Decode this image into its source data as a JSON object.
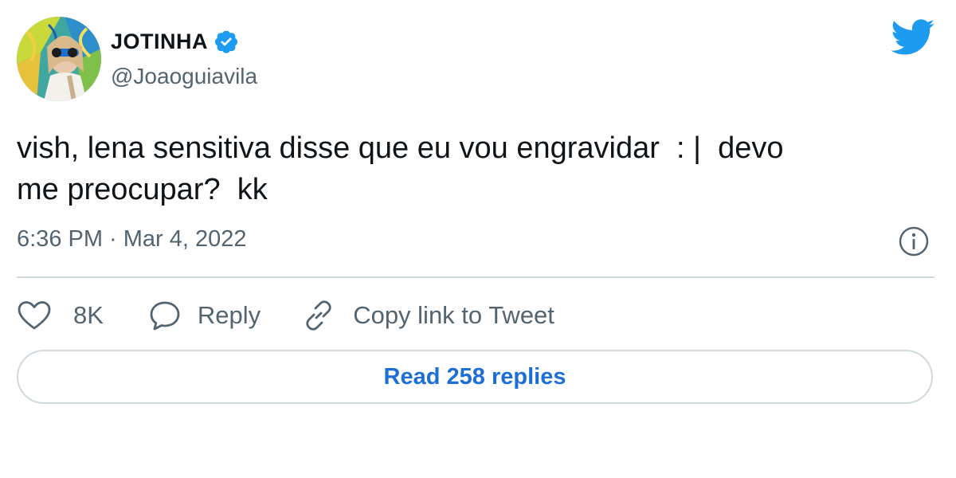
{
  "author": {
    "display_name": "JOTINHA",
    "handle": "@Joaoguiavila",
    "verified": true
  },
  "tweet": {
    "text": "vish, lena sensitiva disse que eu vou engravidar  : |  devo\nme preocupar?  kk",
    "timestamp": "6:36 PM · Mar 4, 2022"
  },
  "actions": {
    "like_count": "8K",
    "reply_label": "Reply",
    "copy_link_label": "Copy link to Tweet"
  },
  "read_replies_label": "Read 258 replies",
  "icons": {
    "brand": "twitter-bird-icon",
    "verified": "verified-badge-icon",
    "info": "info-icon",
    "like": "heart-icon",
    "reply": "speech-bubble-icon",
    "copy_link": "link-icon"
  },
  "colors": {
    "brand_blue": "#1d9bf0",
    "link_blue": "#1d6fd6",
    "text_primary": "#0f1419",
    "text_secondary": "#536471",
    "border": "#cfd9de"
  }
}
